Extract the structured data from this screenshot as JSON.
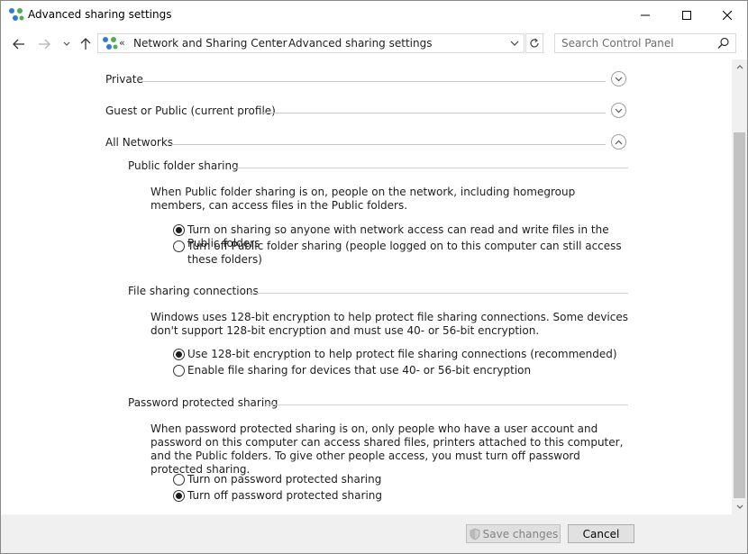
{
  "window": {
    "title": "Advanced sharing settings",
    "icon": "network-sharing-icon"
  },
  "navigation": {
    "back_icon": "arrow-left-icon",
    "forward_icon": "arrow-right-icon",
    "recent_icon": "chevron-down-icon",
    "up_icon": "arrow-up-icon",
    "address": {
      "overflow": "«",
      "crumbs": [
        "Network and Sharing Center",
        "Advanced sharing settings"
      ],
      "separator": "›"
    },
    "search": {
      "placeholder": "Search Control Panel"
    }
  },
  "profiles": {
    "private": "Private",
    "guest_public": "Guest or Public (current profile)",
    "all_networks": "All Networks"
  },
  "public_folder_sharing": {
    "heading": "Public folder sharing",
    "description": "When Public folder sharing is on, people on the network, including homegroup members, can access files in the Public folders.",
    "options": [
      {
        "label": "Turn on sharing so anyone with network access can read and write files in the Public folders",
        "checked": true
      },
      {
        "label": "Turn off Public folder sharing (people logged on to this computer can still access these folders)",
        "checked": false
      }
    ]
  },
  "file_sharing_connections": {
    "heading": "File sharing connections",
    "description": "Windows uses 128-bit encryption to help protect file sharing connections. Some devices don't support 128-bit encryption and must use 40- or 56-bit encryption.",
    "options": [
      {
        "label": "Use 128-bit encryption to help protect file sharing connections (recommended)",
        "checked": true
      },
      {
        "label": "Enable file sharing for devices that use 40- or 56-bit encryption",
        "checked": false
      }
    ]
  },
  "password_protected_sharing": {
    "heading": "Password protected sharing",
    "description": "When password protected sharing is on, only people who have a user account and password on this computer can access shared files, printers attached to this computer, and the Public folders. To give other people access, you must turn off password protected sharing.",
    "options": [
      {
        "label": "Turn on password protected sharing",
        "checked": false
      },
      {
        "label": "Turn off password protected sharing",
        "checked": true
      }
    ]
  },
  "footer": {
    "save_label": "Save changes",
    "cancel_label": "Cancel"
  },
  "colors": {
    "accent": "#0078d7",
    "disabled_text": "#838383"
  }
}
